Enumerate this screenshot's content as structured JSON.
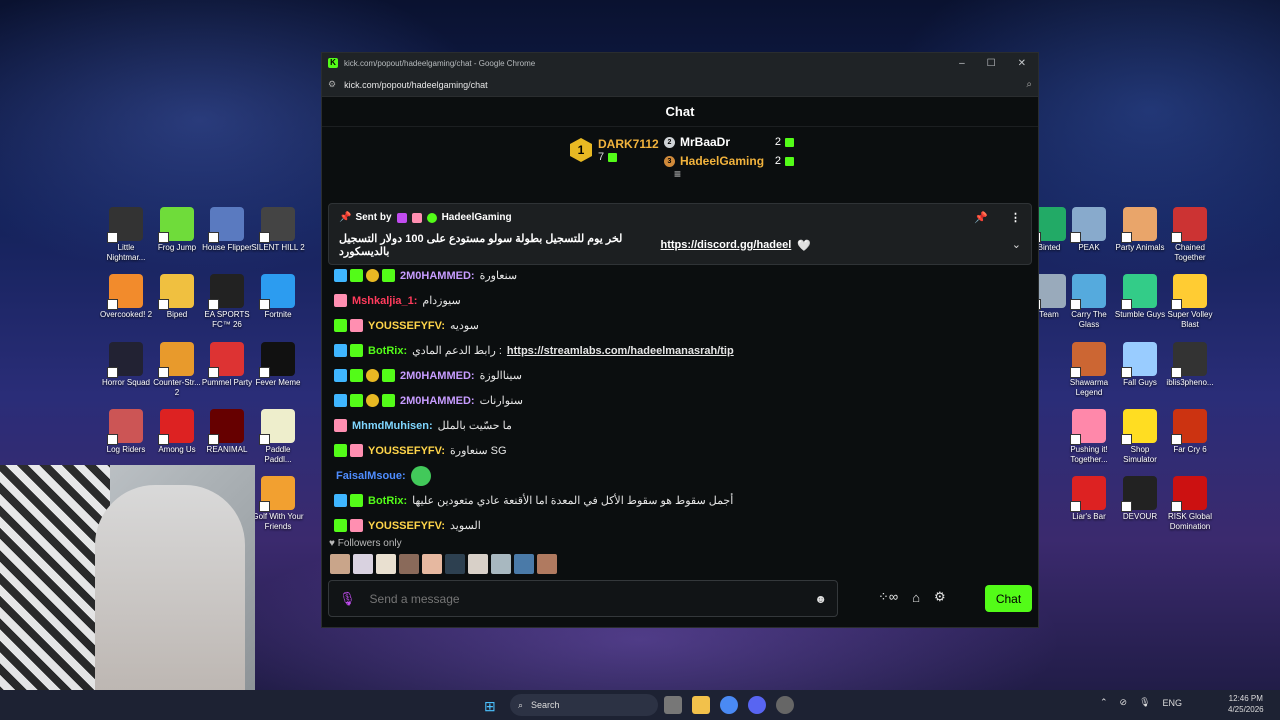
{
  "window": {
    "title": "kick.com/popout/hadeelgaming/chat - Google Chrome",
    "url": "kick.com/popout/hadeelgaming/chat",
    "controls": [
      "–",
      "☐",
      "✕"
    ]
  },
  "chat": {
    "header": "Chat",
    "leaderboard": {
      "first": {
        "rank": "1",
        "name": "DARK7112",
        "count": "7"
      },
      "rows": [
        {
          "rank": "2",
          "name": "MrBaaDr",
          "count": "2",
          "color": "#ffffff"
        },
        {
          "rank": "3",
          "name": "HadeelGaming",
          "count": "2",
          "color": "#f2b33d"
        }
      ]
    },
    "pinned": {
      "sent_by": "Sent by",
      "user": "HadeelGaming",
      "message": "لخر يوم للتسجيل بطولة سولو مستودع على 100 دولار التسجيل بالديسكورد",
      "link": "https://discord.gg/hadeel"
    },
    "messages": [
      {
        "user": "2M0HAMMED:",
        "text": "سنعاورة",
        "color": "#c79cff",
        "badges": [
          "#3fb6ff",
          "#53fc18",
          "#e8b923",
          "#53fc18"
        ]
      },
      {
        "user": "Mshkaljia_1:",
        "text": "سيوزدام",
        "color": "#ff3b5c",
        "badges": [
          "#ff8fb1"
        ]
      },
      {
        "user": "YOUSSEFYFV:",
        "text": "سوديه",
        "color": "#ffd54a",
        "badges": [
          "#53fc18",
          "#ff8fb1"
        ]
      },
      {
        "user": "BotRix:",
        "text": "رابط الدعم المادي :",
        "link": "https://streamlabs.com/hadeelmanasrah/tip",
        "color": "#53fc18",
        "badges": [
          "#3fb6ff",
          "#53fc18"
        ]
      },
      {
        "user": "2M0HAMMED:",
        "text": "سيناالوزة",
        "color": "#c79cff",
        "badges": [
          "#3fb6ff",
          "#53fc18",
          "#e8b923",
          "#53fc18"
        ]
      },
      {
        "user": "2M0HAMMED:",
        "text": "سنوارنات",
        "color": "#c79cff",
        "badges": [
          "#3fb6ff",
          "#53fc18",
          "#e8b923",
          "#53fc18"
        ]
      },
      {
        "user": "MhmdMuhisen:",
        "text": "ما حسّيت بالملل",
        "color": "#7fd6ff",
        "badges": [
          "#ff8fb1"
        ]
      },
      {
        "user": "YOUSSEFYFV:",
        "text": "سنعاورة SG",
        "color": "#ffd54a",
        "badges": [
          "#53fc18",
          "#ff8fb1"
        ]
      },
      {
        "user": "FaisalMsoue:",
        "text": "",
        "color": "#4f8dff",
        "badges": [],
        "emote": true
      },
      {
        "user": "BotRix:",
        "text": "أجمل سقوط هو سقوط الأكل في المعدة اما الأقنعة عادي متعودين عليها",
        "color": "#53fc18",
        "badges": [
          "#3fb6ff",
          "#53fc18"
        ]
      },
      {
        "user": "YOUSSEFYFV:",
        "text": "السويد",
        "color": "#ffd54a",
        "badges": [
          "#53fc18",
          "#ff8fb1"
        ]
      }
    ],
    "followers_label": "Followers only",
    "composer_placeholder": "Send a message",
    "chat_button": "Chat"
  },
  "desktop_icons": [
    {
      "label": "Little Nightmar...",
      "color": "#333"
    },
    {
      "label": "Frog Jump",
      "color": "#6fdc3a"
    },
    {
      "label": "House Flipper",
      "color": "#5a7ac0"
    },
    {
      "label": "SILENT HILL 2",
      "color": "#444"
    },
    {
      "label": "Overcooked! 2",
      "color": "#f28b2c"
    },
    {
      "label": "Biped",
      "color": "#f0c040"
    },
    {
      "label": "EA SPORTS FC™ 26",
      "color": "#222"
    },
    {
      "label": "Fortnite",
      "color": "#2c9cf0"
    },
    {
      "label": "Horror Squad",
      "color": "#223"
    },
    {
      "label": "Counter-Str... 2",
      "color": "#e89a2c"
    },
    {
      "label": "Pummel Party",
      "color": "#d33"
    },
    {
      "label": "Fever Meme",
      "color": "#111"
    },
    {
      "label": "Log Riders",
      "color": "#c55"
    },
    {
      "label": "Among Us",
      "color": "#d22"
    },
    {
      "label": "REANIMAL",
      "color": "#600"
    },
    {
      "label": "Paddle Paddl...",
      "color": "#eec"
    },
    {
      "label": "Golf With Your Friends",
      "color": "#f2a030"
    },
    {
      "label": "Binted",
      "color": "#2a6"
    },
    {
      "label": "PEAK",
      "color": "#8ac"
    },
    {
      "label": "Party Animals",
      "color": "#e9a56a"
    },
    {
      "label": "Chained Together",
      "color": "#c33"
    },
    {
      "label": "Team",
      "color": "#9ab"
    },
    {
      "label": "Carry The Glass",
      "color": "#5ad"
    },
    {
      "label": "Stumble Guys",
      "color": "#3c8"
    },
    {
      "label": "Super Volley Blast",
      "color": "#fc3"
    },
    {
      "label": "Shawarma Legend",
      "color": "#c63"
    },
    {
      "label": "Fall Guys",
      "color": "#9cf"
    },
    {
      "label": "iblis3pheno...",
      "color": "#333"
    },
    {
      "label": "Pushing it! Together...",
      "color": "#f8a"
    },
    {
      "label": "Shop Simulator",
      "color": "#fd2"
    },
    {
      "label": "Far Cry 6",
      "color": "#c31"
    },
    {
      "label": "Liar's Bar",
      "color": "#d22"
    },
    {
      "label": "DEVOUR",
      "color": "#222"
    },
    {
      "label": "RISK Global Domination",
      "color": "#c11"
    }
  ],
  "taskbar": {
    "search_label": "Search",
    "tray_lang": "ENG",
    "time": "12:46 PM",
    "date": "4/25/2026"
  }
}
